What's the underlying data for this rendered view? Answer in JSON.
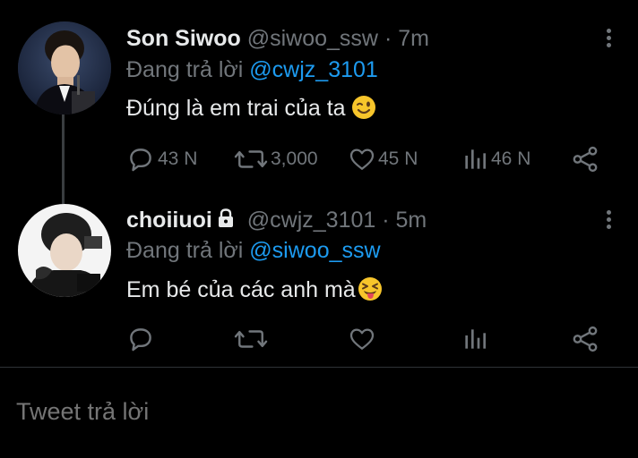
{
  "tweets": [
    {
      "name": "Son Siwoo",
      "handle": "@siwoo_ssw",
      "separator": "·",
      "time": "7m",
      "reply_prefix": "Đang trả lời",
      "reply_to": "@cwjz_3101",
      "text": "Đúng là em trai của ta",
      "emoji": "winking-face",
      "protected": false,
      "actions": {
        "replies": "43 N",
        "retweets": "3,000",
        "likes": "45 N",
        "views": "46 N"
      }
    },
    {
      "name": "choiiuoi",
      "handle": "@cwjz_3101",
      "separator": "·",
      "time": "5m",
      "reply_prefix": "Đang trả lời",
      "reply_to": "@siwoo_ssw",
      "text": "Em bé của các anh mà",
      "emoji": "squinting-face-with-tongue",
      "protected": true,
      "actions": {
        "replies": "",
        "retweets": "",
        "likes": "",
        "views": ""
      }
    }
  ],
  "composer": {
    "placeholder": "Tweet trả lời"
  },
  "colors": {
    "background": "#000000",
    "text": "#e7e9ea",
    "muted": "#71767b",
    "link": "#1d9bf0",
    "divider": "#2f3336"
  },
  "icons": {
    "reply": "speech-bubble-icon",
    "retweet": "retweet-arrows-icon",
    "like": "heart-icon",
    "views": "bar-chart-icon",
    "share": "share-nodes-icon",
    "more": "vertical-dots-icon",
    "lock": "lock-icon"
  }
}
